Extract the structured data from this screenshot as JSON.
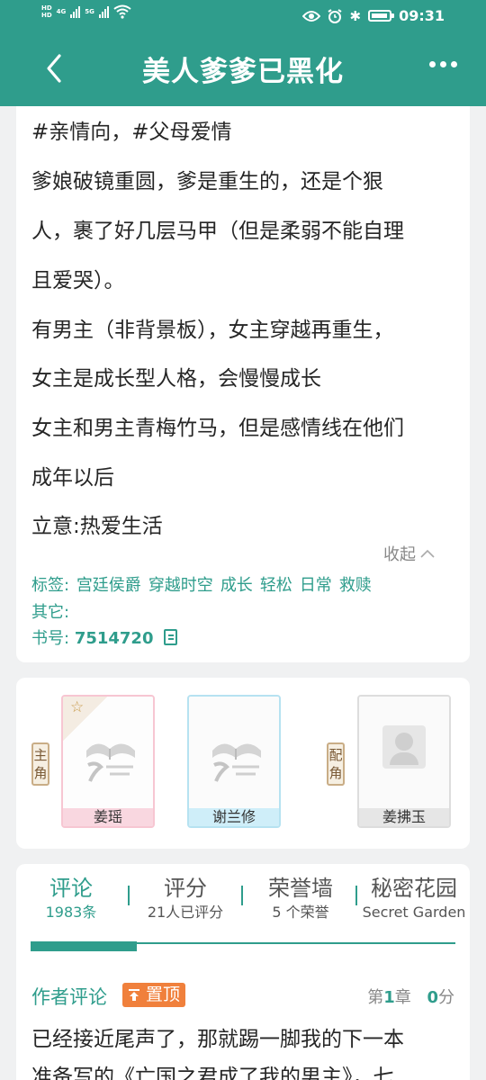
{
  "status_bar": {
    "hd1": "HD",
    "hd2": "HD",
    "net1": "4G",
    "net2": "5G",
    "time": "09:31"
  },
  "app_bar": {
    "title": "美人爹爹已黑化"
  },
  "synopsis": {
    "paragraphs": [
      "#亲情向，#父母爱情",
      "爹娘破镜重圆，爹是重生的，还是个狠",
      "人，裹了好几层马甲（但是柔弱不能自理",
      "且爱哭）。",
      "有男主（非背景板），女主穿越再重生，",
      "女主是成长型人格，会慢慢成长",
      "女主和男主青梅竹马，但是感情线在他们",
      "成年以后",
      "立意:热爱生活"
    ],
    "collapse_label": "收起",
    "tags_label": "标签:",
    "tags": [
      "宫廷侯爵",
      "穿越时空",
      "成长",
      "轻松",
      "日常",
      "救赎"
    ],
    "other_label": "其它:",
    "book_id_label": "书号:",
    "book_id": "7514720"
  },
  "characters": {
    "main_label": [
      "主",
      "角"
    ],
    "supporting_label": [
      "配",
      "角"
    ],
    "main": [
      {
        "name": "姜瑶",
        "starred": true
      },
      {
        "name": "谢兰修",
        "starred": false
      }
    ],
    "supporting": [
      {
        "name": "姜拂玉"
      }
    ]
  },
  "tabs": [
    {
      "label": "评论",
      "sub": "1983条",
      "active": true
    },
    {
      "label": "评分",
      "sub": "21人已评分",
      "active": false
    },
    {
      "label": "荣誉墙",
      "sub": "5 个荣誉",
      "active": false
    },
    {
      "label": "秘密花园",
      "sub": "Secret Garden",
      "active": false
    }
  ],
  "author_comment": {
    "title": "作者评论",
    "pin_label": "置顶",
    "chapter_prefix": "第",
    "chapter_num": "1",
    "chapter_suffix": "章",
    "score": "0",
    "score_suffix": "分",
    "lines": [
      "已经接近尾声了，那就踢一脚我的下一本",
      "准备写的《亡国之君成了我的男主》，七"
    ]
  },
  "colors": {
    "accent": "#2f9d8c",
    "pin": "#f0803c"
  }
}
